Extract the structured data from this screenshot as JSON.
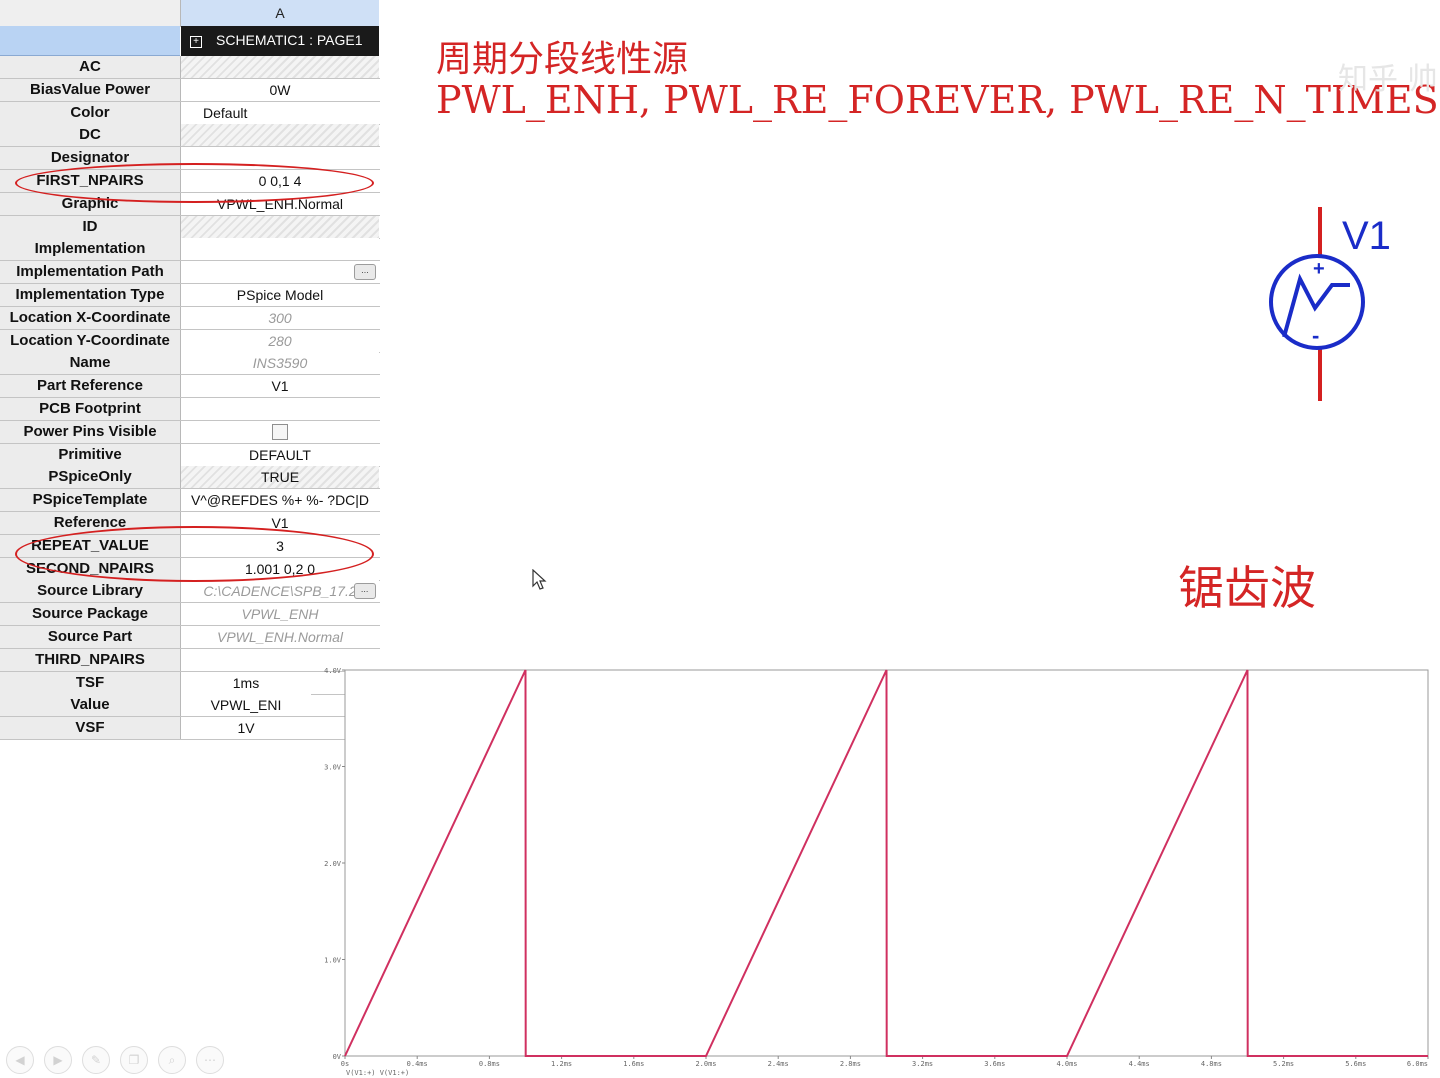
{
  "grid": {
    "column_header": "A",
    "schematic_label": "SCHEMATIC1 : PAGE1",
    "rows": [
      {
        "name": "AC",
        "value": "",
        "style": "hatch"
      },
      {
        "name": "BiasValue Power",
        "value": "0W"
      },
      {
        "name": "Color",
        "value": "Default",
        "style": "left"
      },
      {
        "name": "DC",
        "value": "",
        "style": "hatch"
      },
      {
        "name": "Designator",
        "value": ""
      },
      {
        "name": "FIRST_NPAIRS",
        "value": "0 0,1 4"
      },
      {
        "name": "Graphic",
        "value": "VPWL_ENH.Normal"
      },
      {
        "name": "ID",
        "value": "",
        "style": "hatch"
      },
      {
        "name": "Implementation",
        "value": ""
      },
      {
        "name": "Implementation Path",
        "value": "",
        "button": "..."
      },
      {
        "name": "Implementation Type",
        "value": "PSpice Model"
      },
      {
        "name": "Location X-Coordinate",
        "value": "300",
        "style": "gray"
      },
      {
        "name": "Location Y-Coordinate",
        "value": "280",
        "style": "gray"
      },
      {
        "name": "Name",
        "value": "INS3590",
        "style": "gray"
      },
      {
        "name": "Part Reference",
        "value": "V1"
      },
      {
        "name": "PCB Footprint",
        "value": ""
      },
      {
        "name": "Power Pins Visible",
        "value": "",
        "checkbox": true
      },
      {
        "name": "Primitive",
        "value": "DEFAULT"
      },
      {
        "name": "PSpiceOnly",
        "value": "TRUE",
        "style": "hatch"
      },
      {
        "name": "PSpiceTemplate",
        "value": "V^@REFDES %+ %- ?DC|D"
      },
      {
        "name": "Reference",
        "value": "V1"
      },
      {
        "name": "REPEAT_VALUE",
        "value": "3"
      },
      {
        "name": "SECOND_NPAIRS",
        "value": "1.001 0,2 0"
      },
      {
        "name": "Source Library",
        "value": "C:\\CADENCE\\SPB_17.2",
        "style": "gray",
        "button": "..."
      },
      {
        "name": "Source Package",
        "value": "VPWL_ENH",
        "style": "gray"
      },
      {
        "name": "Source Part",
        "value": "VPWL_ENH.Normal",
        "style": "gray"
      },
      {
        "name": "THIRD_NPAIRS",
        "value": ""
      },
      {
        "name": "TSF",
        "value": "1ms",
        "short": true
      },
      {
        "name": "Value",
        "value": "VPWL_ENI",
        "short": true
      },
      {
        "name": "VSF",
        "value": "1V",
        "short": true
      }
    ]
  },
  "annotations": {
    "title_cn": "周期分段线性源",
    "title_en": "PWL_ENH, PWL_RE_FOREVER, PWL_RE_N_TIMES",
    "sawtooth_label": "锯齿波",
    "symbol_label": "V1",
    "watermark": "知乎 帅",
    "accent_color": "#d42525",
    "symbol_color": "#1a2cc8"
  },
  "chart_data": {
    "type": "line",
    "title": "",
    "xlabel": "",
    "ylabel": "",
    "xlim": [
      0,
      6.0
    ],
    "ylim": [
      0,
      4.0
    ],
    "x_ticks": [
      "0s",
      "0.4ms",
      "0.8ms",
      "1.2ms",
      "1.6ms",
      "2.0ms",
      "2.4ms",
      "2.8ms",
      "3.2ms",
      "3.6ms",
      "4.0ms",
      "4.4ms",
      "4.8ms",
      "5.2ms",
      "5.6ms",
      "6.0ms"
    ],
    "y_ticks": [
      "0V",
      "1.0V",
      "2.0V",
      "3.0V",
      "4.0V"
    ],
    "legend_text": "V(V1:+)  V(V1:+)",
    "series": [
      {
        "color": "#d03060",
        "x": [
          0,
          1.0,
          1.001,
          2.0,
          3.0,
          3.001,
          4.0,
          5.0,
          5.001,
          6.0
        ],
        "values": [
          0,
          4.0,
          0,
          0,
          4.0,
          0,
          0,
          4.0,
          0,
          0
        ]
      }
    ]
  },
  "toolbar": {
    "icons": [
      "prev-icon",
      "next-icon",
      "pen-icon",
      "copy-icon",
      "zoom-icon",
      "more-icon"
    ],
    "glyphs": [
      "◀",
      "▶",
      "✎",
      "❐",
      "⌕",
      "⋯"
    ]
  }
}
